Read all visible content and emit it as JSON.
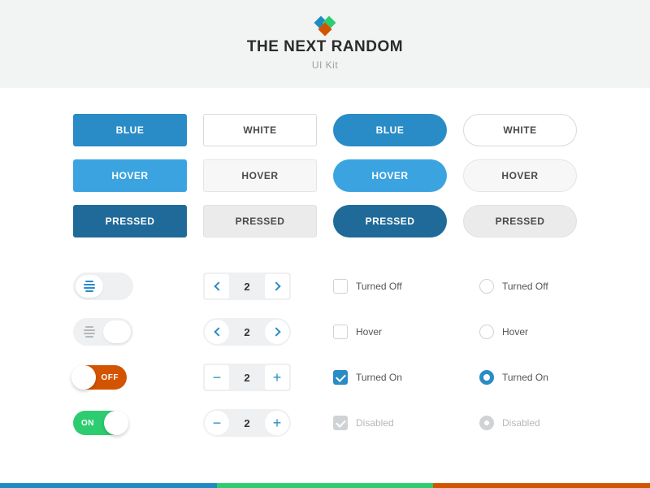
{
  "header": {
    "title": "THE NEXT RANDOM",
    "subtitle": "UI Kit"
  },
  "buttons": {
    "blue": "BLUE",
    "white": "WHITE",
    "hover": "HOVER",
    "pressed": "PRESSED"
  },
  "switch": {
    "off": "OFF",
    "on": "ON"
  },
  "stepper": {
    "v1": "2",
    "v2": "2",
    "v3": "2",
    "v4": "2"
  },
  "checkbox": {
    "off": "Turned Off",
    "hover": "Hover",
    "on": "Turned On",
    "disabled": "Disabled"
  },
  "radio": {
    "off": "Turned Off",
    "hover": "Hover",
    "on": "Turned On",
    "disabled": "Disabled"
  },
  "colors": {
    "blue": "#2a8cc7",
    "green": "#2ecc71",
    "orange": "#d35400"
  }
}
